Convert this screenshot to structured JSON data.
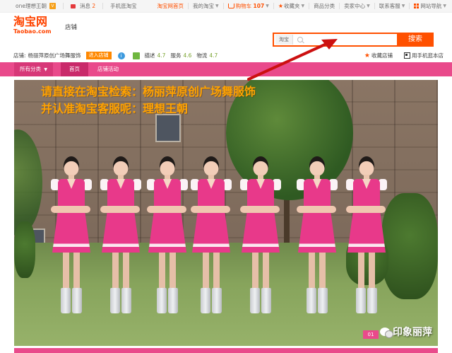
{
  "sitebar": {
    "user": "one理想王朝",
    "message_label": "消息",
    "message_count": "2",
    "mobile": "手机逛淘宝",
    "links": [
      "淘宝网首页",
      "我的淘宝"
    ],
    "cart_label": "购物车",
    "cart_count": "107",
    "favorites": "收藏夹",
    "categories": "商品分类",
    "seller": "卖家中心",
    "support": "联系客服",
    "sitemap": "网站导航"
  },
  "header": {
    "logo_cn": "淘宝网",
    "logo_en": "Taobao.com",
    "shop_type": "店铺",
    "search_scope": "淘宝",
    "search_placeholder": "",
    "search_button": "搜索"
  },
  "shopbar": {
    "label": "店铺:",
    "shop_name": "杨丽萍原创广场舞服饰",
    "enter_button": "进入店铺",
    "scores": [
      {
        "label": "描述",
        "value": "4.7"
      },
      {
        "label": "服务",
        "value": "4.6"
      },
      {
        "label": "物流",
        "value": "4.7"
      }
    ],
    "favorite_shop": "收藏店铺",
    "mobile_shop": "用手机逛本店"
  },
  "nav": {
    "all_categories": "所有分类",
    "home": "首页",
    "activity": "店铺活动"
  },
  "banner": {
    "line1": "请直接在淘宝检索：杨丽萍原创广场舞服饰",
    "line2": "并认准淘宝客服呢：理想王朝",
    "page_indicator": "01",
    "watermark": "印象丽萍"
  },
  "colors": {
    "accent": "#ff5000",
    "nav_pink": "#e94a8b",
    "banner_text": "#ffa200",
    "arrow": "#cc1010"
  }
}
